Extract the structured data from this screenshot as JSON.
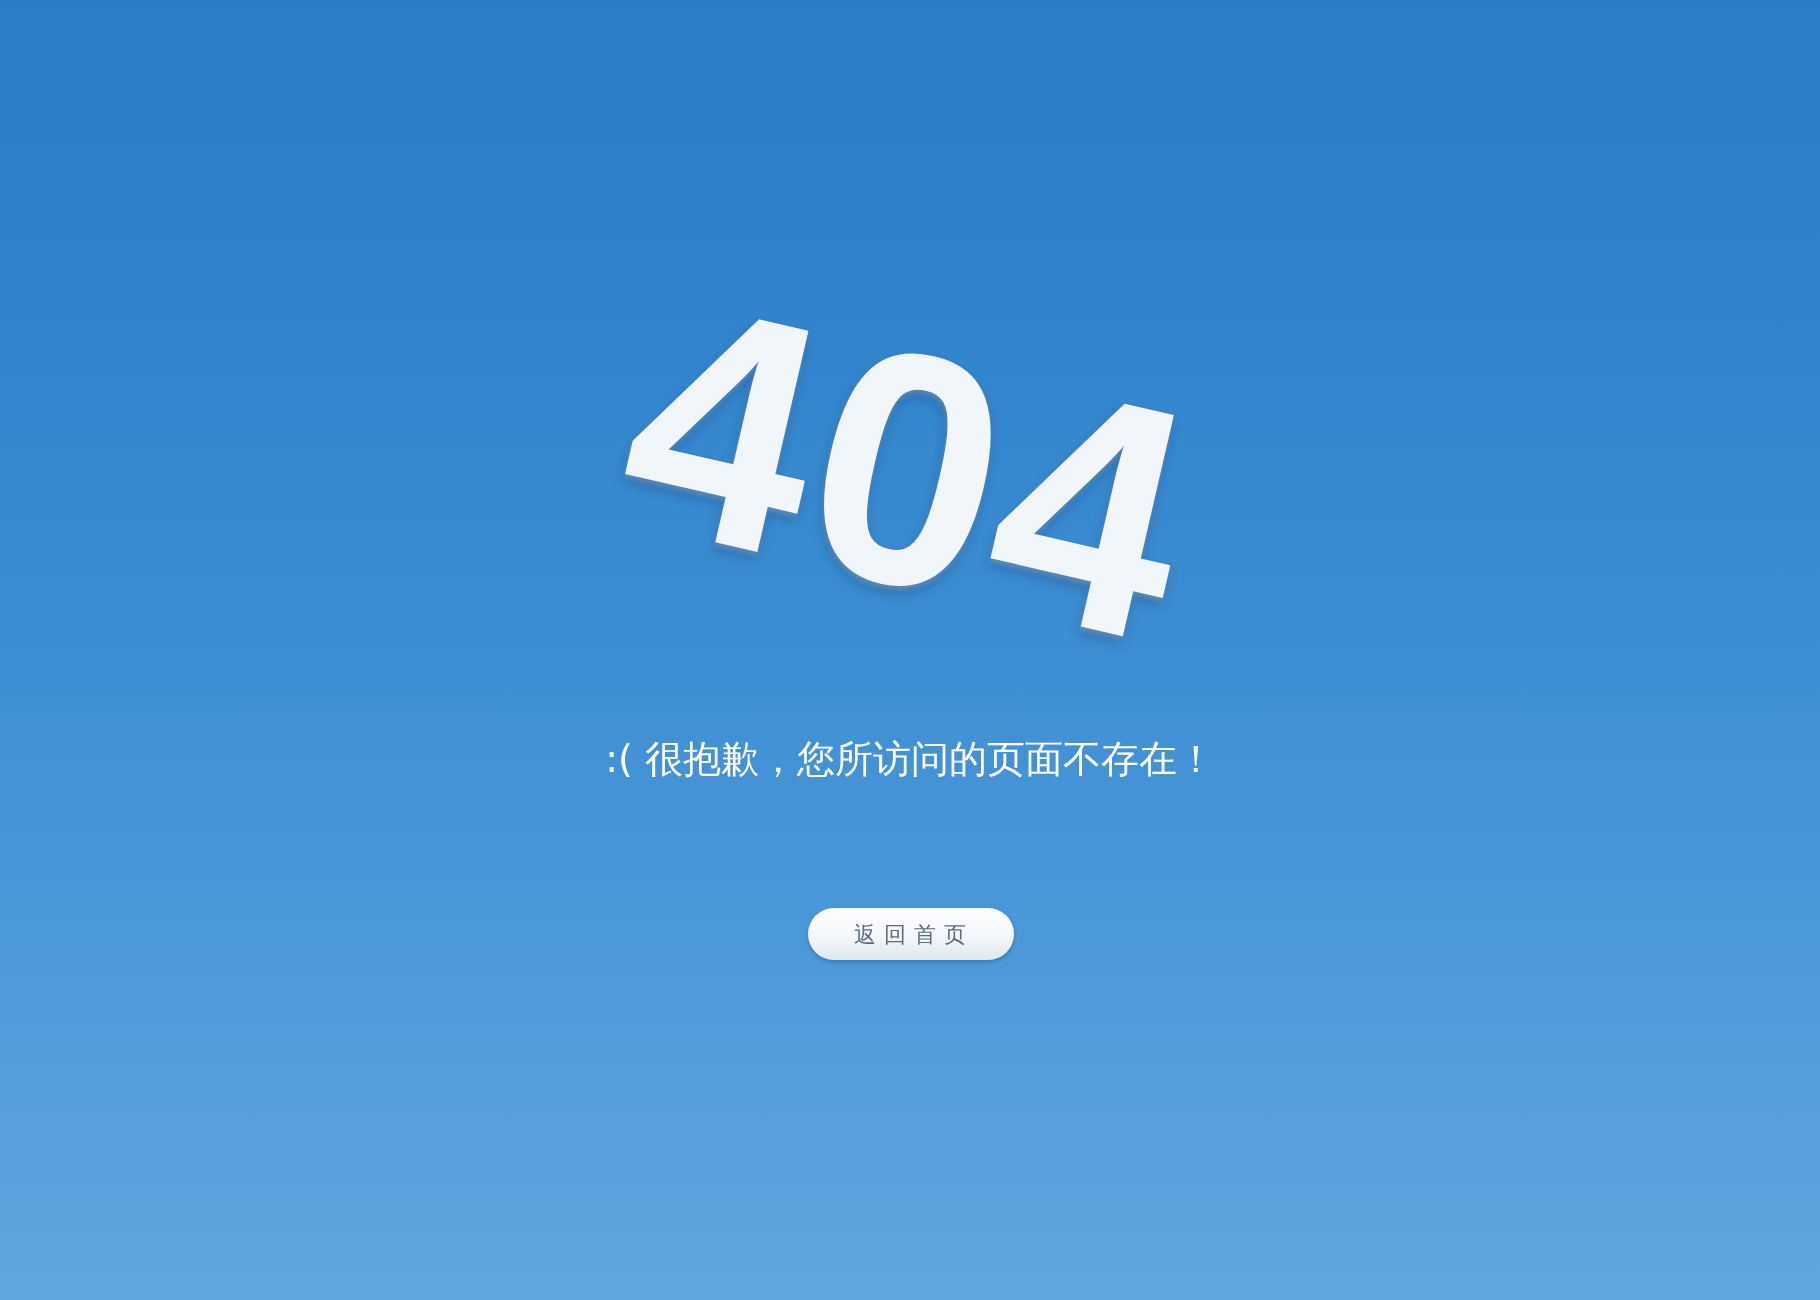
{
  "error_code": "404",
  "message": ":( 很抱歉，您所访问的页面不存在！",
  "button": {
    "label": "返回首页"
  }
}
